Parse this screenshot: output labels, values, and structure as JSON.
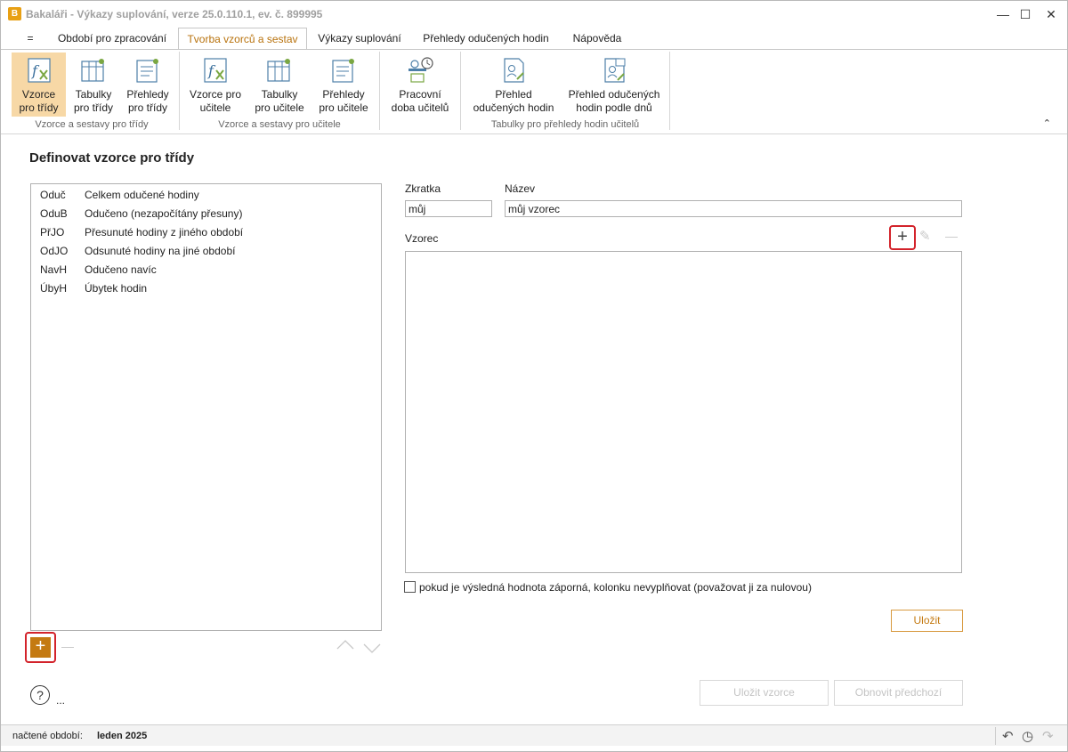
{
  "window": {
    "title": "Bakaláři - Výkazy suplování, verze 25.0.110.1, ev. č. 899995",
    "minimize": "—",
    "maximize": "☐",
    "close": "✕"
  },
  "tabs": [
    {
      "label": "="
    },
    {
      "label": "Období pro zpracování"
    },
    {
      "label": "Tvorba vzorců a sestav",
      "active": true
    },
    {
      "label": "Výkazy suplování"
    },
    {
      "label": "Přehledy odučených hodin"
    },
    {
      "label": "Nápověda"
    }
  ],
  "ribbon": {
    "buttons": [
      {
        "line1": "Vzorce",
        "line2": "pro třídy",
        "icon": "formula-icon",
        "selected": true
      },
      {
        "line1": "Tabulky",
        "line2": "pro třídy",
        "icon": "table-icon"
      },
      {
        "line1": "Přehledy",
        "line2": "pro třídy",
        "icon": "report-icon"
      },
      {
        "line1": "Vzorce pro",
        "line2": "učitele",
        "icon": "formula-icon"
      },
      {
        "line1": "Tabulky",
        "line2": "pro učitele",
        "icon": "table-icon"
      },
      {
        "line1": "Přehledy",
        "line2": "pro učitele",
        "icon": "report-icon"
      },
      {
        "line1": "Pracovní",
        "line2": "doba učitelů",
        "icon": "worktime-icon"
      },
      {
        "line1": "Přehled",
        "line2": "odučených hodin",
        "icon": "overview-icon"
      },
      {
        "line1": "Přehled odučených",
        "line2": "hodin podle dnů",
        "icon": "daily-overview-icon"
      }
    ],
    "groups": [
      "Vzorce a sestavy pro třídy",
      "Vzorce a sestavy pro učitele",
      "Tabulky pro přehledy hodin učitelů"
    ],
    "collapse": "⌃"
  },
  "page": {
    "title": "Definovat vzorce pro třídy"
  },
  "list": [
    {
      "abbr": "Oduč",
      "name": "Celkem odučené hodiny"
    },
    {
      "abbr": "OduB",
      "name": "Odučeno (nezapočítány přesuny)"
    },
    {
      "abbr": "PřJO",
      "name": "Přesunuté hodiny z jiného období"
    },
    {
      "abbr": "OdJO",
      "name": "Odsunuté hodiny na jiné období"
    },
    {
      "abbr": "NavH",
      "name": "Odučeno navíc"
    },
    {
      "abbr": "ÚbyH",
      "name": "Úbytek hodin"
    }
  ],
  "form": {
    "abbr_label": "Zkratka",
    "abbr_value": "můj",
    "name_label": "Název",
    "name_value": "můj vzorec",
    "formula_label": "Vzorec",
    "negative_checkbox_label": "pokud je výsledná hodnota záporná, kolonku nevyplňovat (považovat ji za nulovou)",
    "negative_checked": false,
    "save_label": "Uložit"
  },
  "bottom": {
    "save_formula_label": "Uložit vzorce",
    "restore_label": "Obnovit předchozí",
    "help": "?",
    "ellipsis": "..."
  },
  "status": {
    "label": "načtené období:",
    "value": "leden 2025"
  }
}
